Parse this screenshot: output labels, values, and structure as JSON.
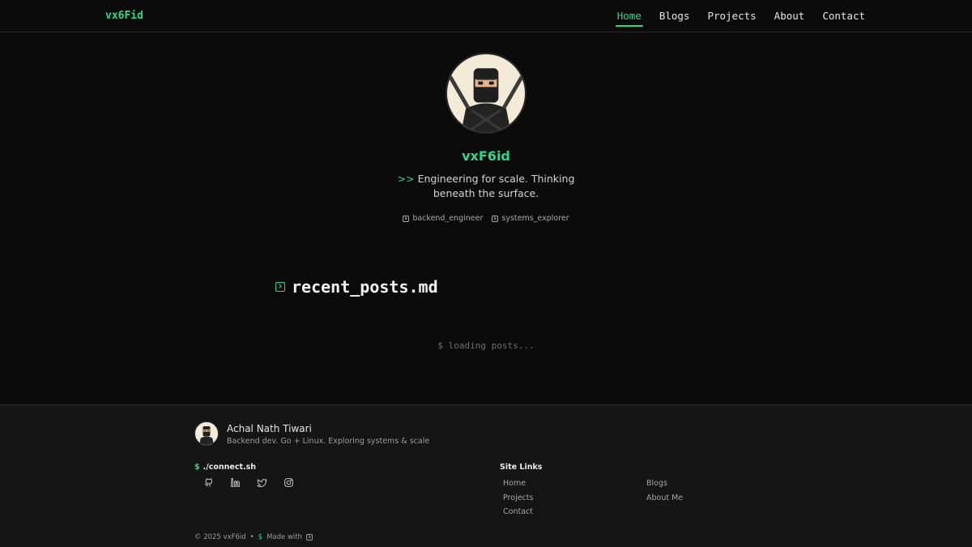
{
  "header": {
    "brand": "vx6Fid",
    "nav": [
      {
        "label": "Home",
        "active": true
      },
      {
        "label": "Blogs"
      },
      {
        "label": "Projects"
      },
      {
        "label": "About"
      },
      {
        "label": "Contact"
      }
    ]
  },
  "hero": {
    "avatar_icon": "ninja-avatar",
    "name": "vxF6id",
    "tagline_prompt": ">>",
    "tagline": "Engineering for scale. Thinking beneath the surface.",
    "tags": [
      "backend_engineer",
      "systems_explorer"
    ]
  },
  "posts": {
    "title": "recent_posts.md",
    "loading": "$ loading posts..."
  },
  "footer": {
    "name": "Achal Nath Tiwari",
    "bio": "Backend dev. Go + Linux. Exploring systems & scale",
    "connect_prefix": "$",
    "connect_label": "./connect.sh",
    "socials": [
      "github-icon",
      "linkedin-icon",
      "twitter-icon",
      "instagram-icon"
    ],
    "site_links_title": "Site Links",
    "site_links": [
      "Home",
      "Blogs",
      "Projects",
      "About Me",
      "Contact"
    ],
    "copyright": "© 2025 vxF6id",
    "separator": "•",
    "made_prefix": "$",
    "made_with": "Made with"
  },
  "colors": {
    "accent": "#2bd98a",
    "background": "#0b0b0b",
    "footer_bg": "#151515"
  }
}
